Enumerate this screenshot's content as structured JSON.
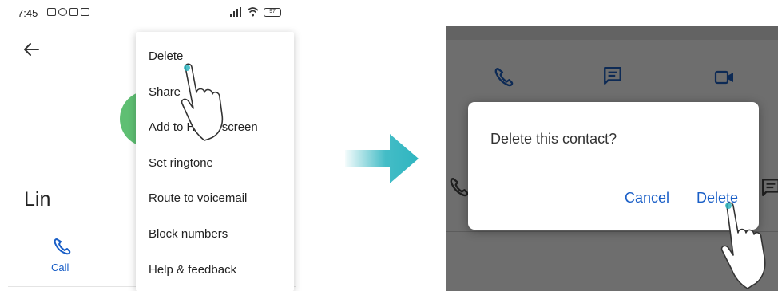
{
  "left_screen": {
    "status": {
      "time": "7:45",
      "battery": "97"
    },
    "contact_name": "Lin",
    "call_label": "Call",
    "menu": {
      "items": [
        "Delete",
        "Share",
        "Add to Home screen",
        "Set ringtone",
        "Route to voicemail",
        "Block numbers",
        "Help & feedback"
      ]
    }
  },
  "right_screen": {
    "dialog": {
      "title": "Delete this contact?",
      "cancel_label": "Cancel",
      "delete_label": "Delete"
    }
  },
  "colors": {
    "accent": "#1a5fc7",
    "arrow": "#2fb5c0",
    "avatar": "#5fbf73",
    "overlay": "#6e6e6e"
  },
  "icons": [
    "back-arrow-icon",
    "phone-icon",
    "message-icon",
    "video-icon",
    "hand-pointer-icon",
    "arrow-right-icon"
  ]
}
